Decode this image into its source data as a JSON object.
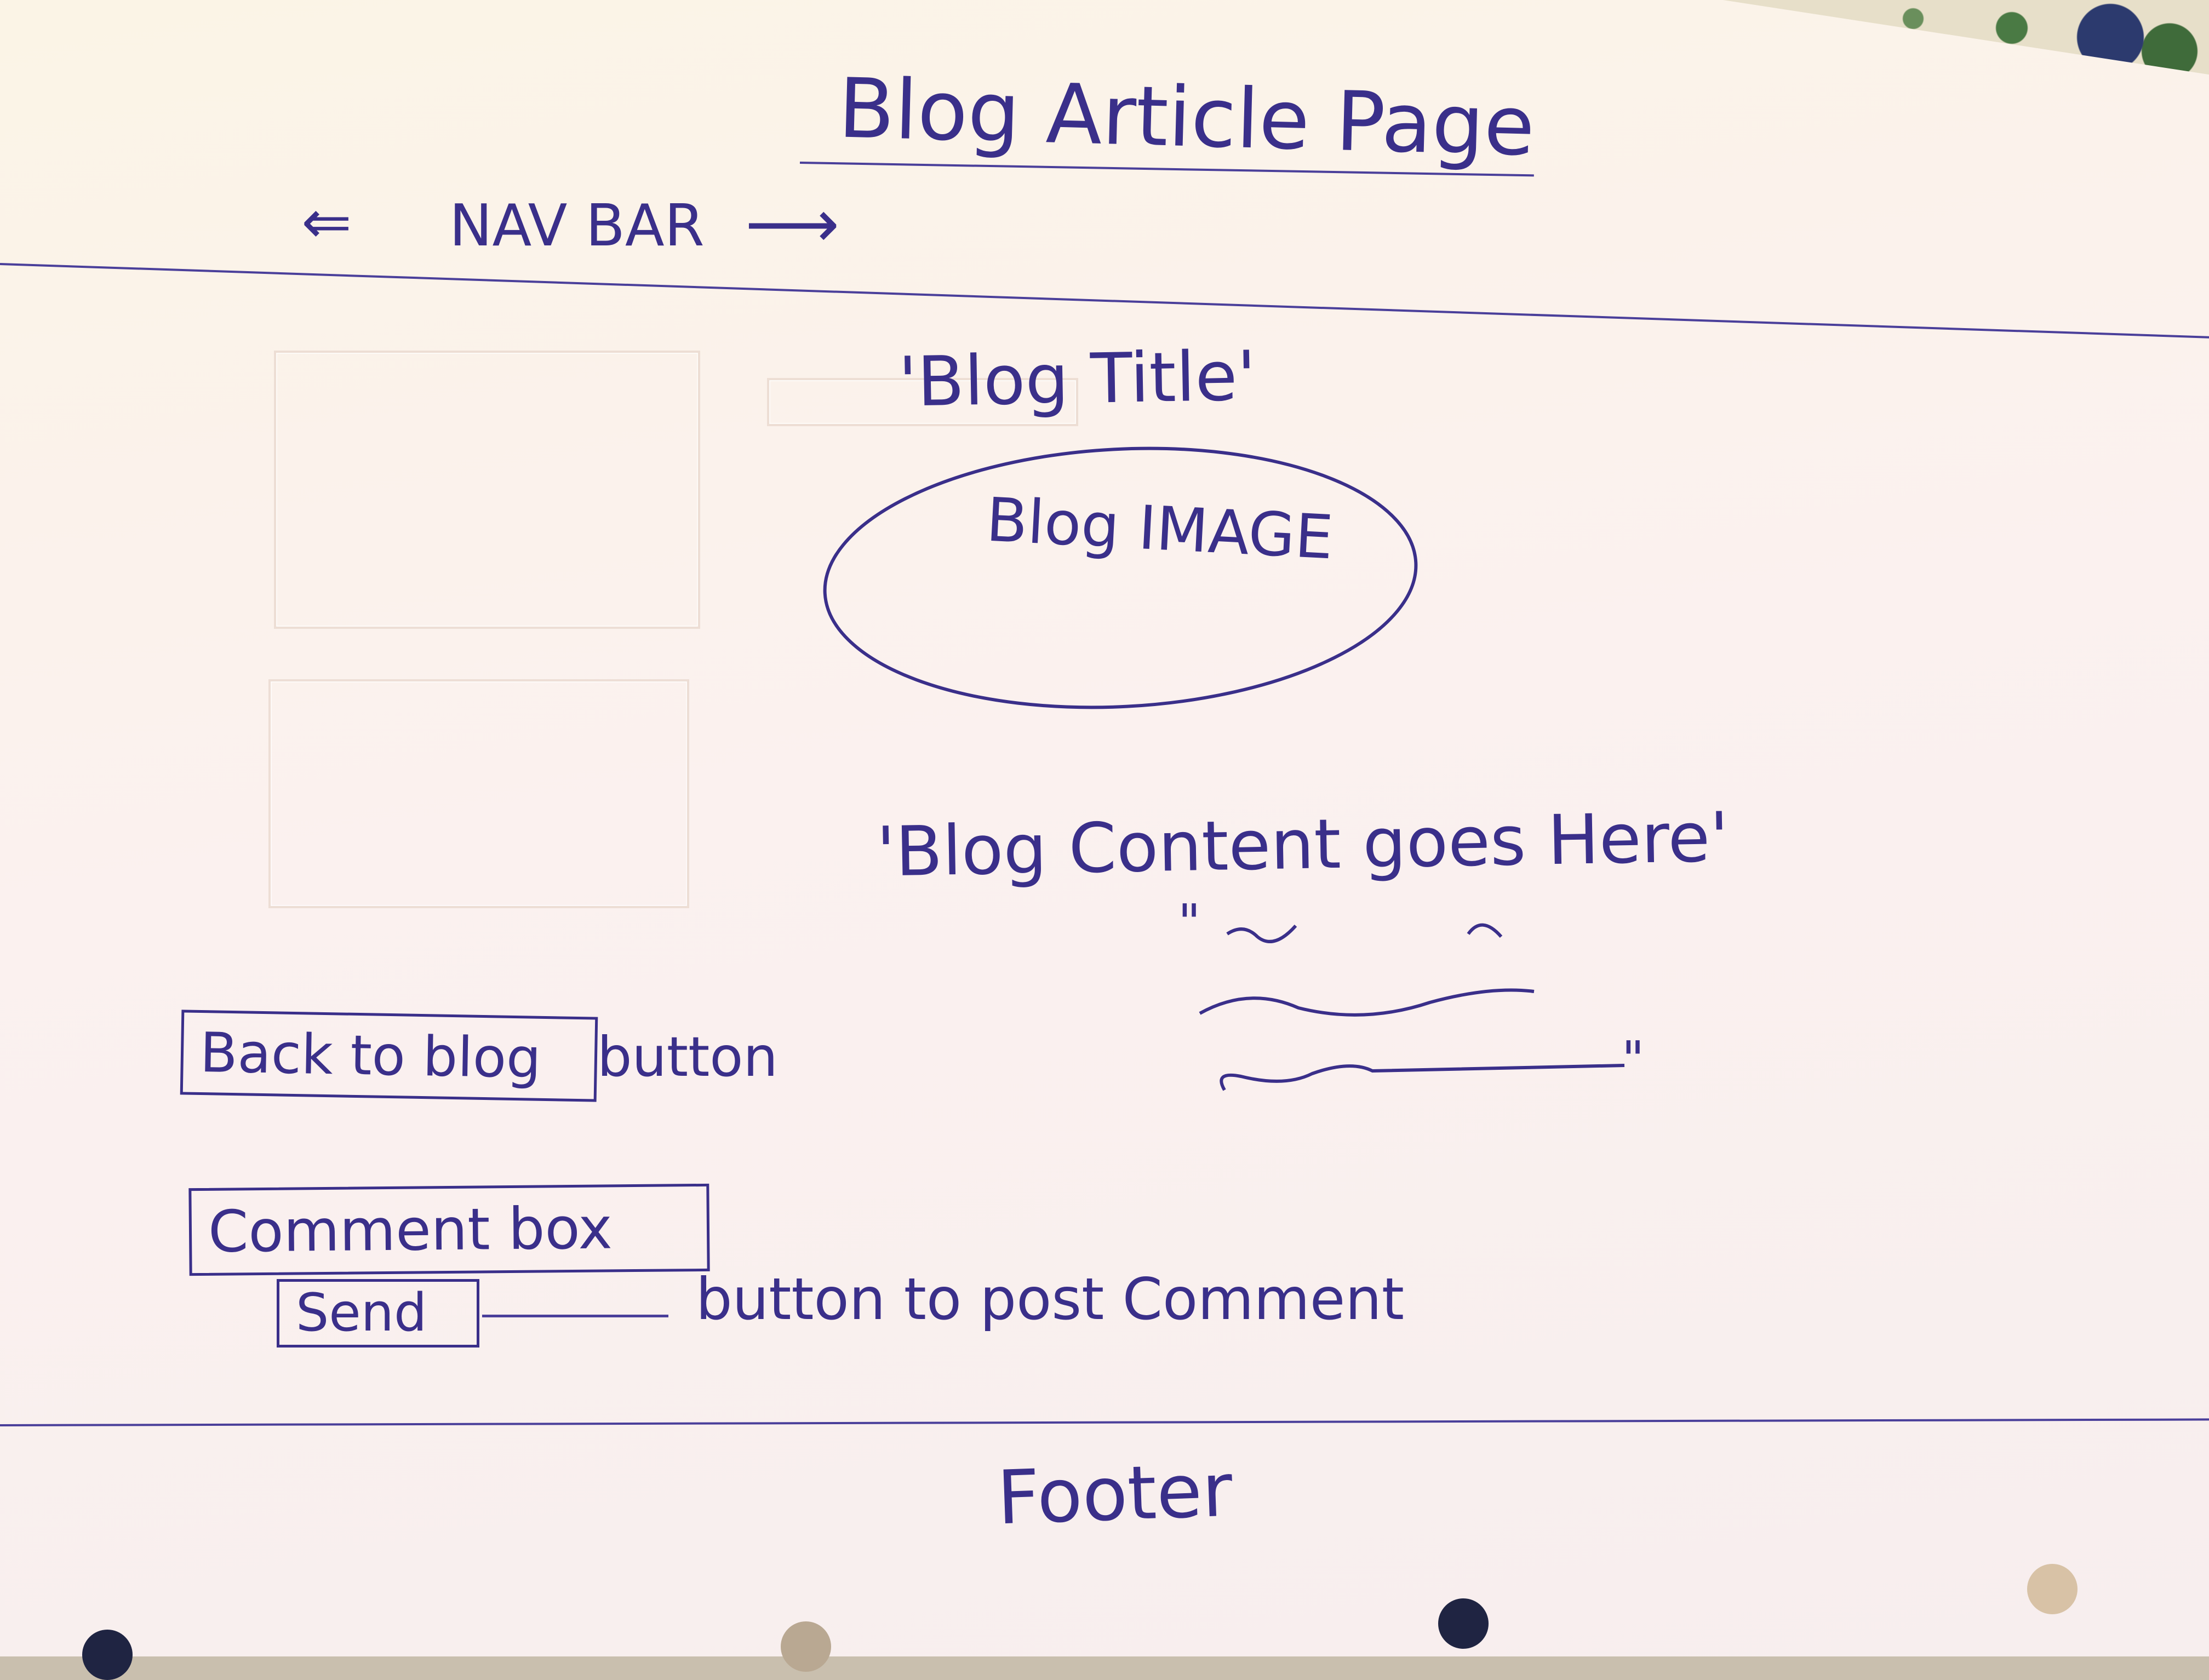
{
  "sketch": {
    "page_title": "Blog Article Page",
    "navbar_label": "NAV BAR",
    "nav_left_arrow": "⇐",
    "nav_right_arrow": "⟶",
    "blog_title": "'Blog Title'",
    "blog_image_label": "Blog IMAGE",
    "blog_content": "'Blog Content goes Here'",
    "quote_open": "\"",
    "quote_close": "\"",
    "back_button_label": "Back to blog",
    "back_button_note": "button",
    "comment_box_label": "Comment box",
    "send_button_label": "Send",
    "send_note": "button to post Comment",
    "footer_label": "Footer"
  },
  "colors": {
    "ink": "#3a2f8a",
    "paper": "#fbf2ea"
  }
}
